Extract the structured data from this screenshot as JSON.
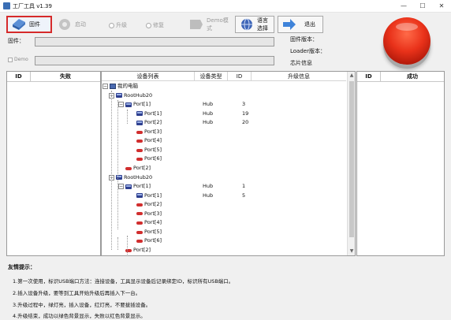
{
  "window": {
    "title": "工厂工具 v1.39",
    "minimize": "—",
    "maximize": "☐",
    "close": "✕"
  },
  "toolbar": {
    "firmware": "固件",
    "start": "启动",
    "upgrade": "升级",
    "repair": "修复",
    "demo_mode": "Demo模式",
    "language": "语言选择",
    "exit": "退出"
  },
  "info": {
    "firmware_label": "固件：",
    "firmware_value": "",
    "demo_label": "Demo",
    "demo_value": "",
    "firmware_version_label": "固件版本：",
    "loader_version_label": "Loader版本：",
    "chip_info_label": "芯片信息"
  },
  "fail_panel": {
    "id_header": "ID",
    "title_header": "失败"
  },
  "success_panel": {
    "id_header": "ID",
    "title_header": "成功"
  },
  "device_tree": {
    "headers": {
      "device_list": "设备列表",
      "device_type": "设备类型",
      "id": "ID",
      "upgrade_info": "升级信息"
    },
    "nodes": [
      {
        "label": "我的电脑",
        "type": "",
        "id": ""
      },
      {
        "label": "RootHub20",
        "type": "",
        "id": ""
      },
      {
        "label": "Port[1]",
        "type": "Hub",
        "id": "3"
      },
      {
        "label": "Port[1]",
        "type": "Hub",
        "id": "19"
      },
      {
        "label": "Port[2]",
        "type": "Hub",
        "id": "20"
      },
      {
        "label": "Port[3]",
        "type": "",
        "id": ""
      },
      {
        "label": "Port[4]",
        "type": "",
        "id": ""
      },
      {
        "label": "Port[5]",
        "type": "",
        "id": ""
      },
      {
        "label": "Port[6]",
        "type": "",
        "id": ""
      },
      {
        "label": "Port[2]",
        "type": "",
        "id": ""
      },
      {
        "label": "RootHub20",
        "type": "",
        "id": ""
      },
      {
        "label": "Port[1]",
        "type": "Hub",
        "id": "1"
      },
      {
        "label": "Port[1]",
        "type": "Hub",
        "id": "5"
      },
      {
        "label": "Port[2]",
        "type": "",
        "id": ""
      },
      {
        "label": "Port[3]",
        "type": "",
        "id": ""
      },
      {
        "label": "Port[4]",
        "type": "",
        "id": ""
      },
      {
        "label": "Port[5]",
        "type": "",
        "id": ""
      },
      {
        "label": "Port[6]",
        "type": "",
        "id": ""
      },
      {
        "label": "Port[2]",
        "type": "",
        "id": ""
      }
    ]
  },
  "tips": {
    "title": "友情提示：",
    "lines": [
      "1.第一次使用，标识USB端口方法：连接设备，工具显示设备后记录绑定ID，标识所有USB端口。",
      "2.插入设备升级，要等到工具开始升级后再插入下一台。",
      "3.升级过程中，绿灯亮，插入设备，红灯亮，不要拔插设备。",
      "4.升级结束，成功以绿色背景显示，失败以红色背景显示。"
    ]
  },
  "colors": {
    "highlight_border": "#d62a2a",
    "status_button": "#e9321a",
    "hub_icon": "#2e3f8f",
    "usb_icon": "#d12e2e"
  }
}
